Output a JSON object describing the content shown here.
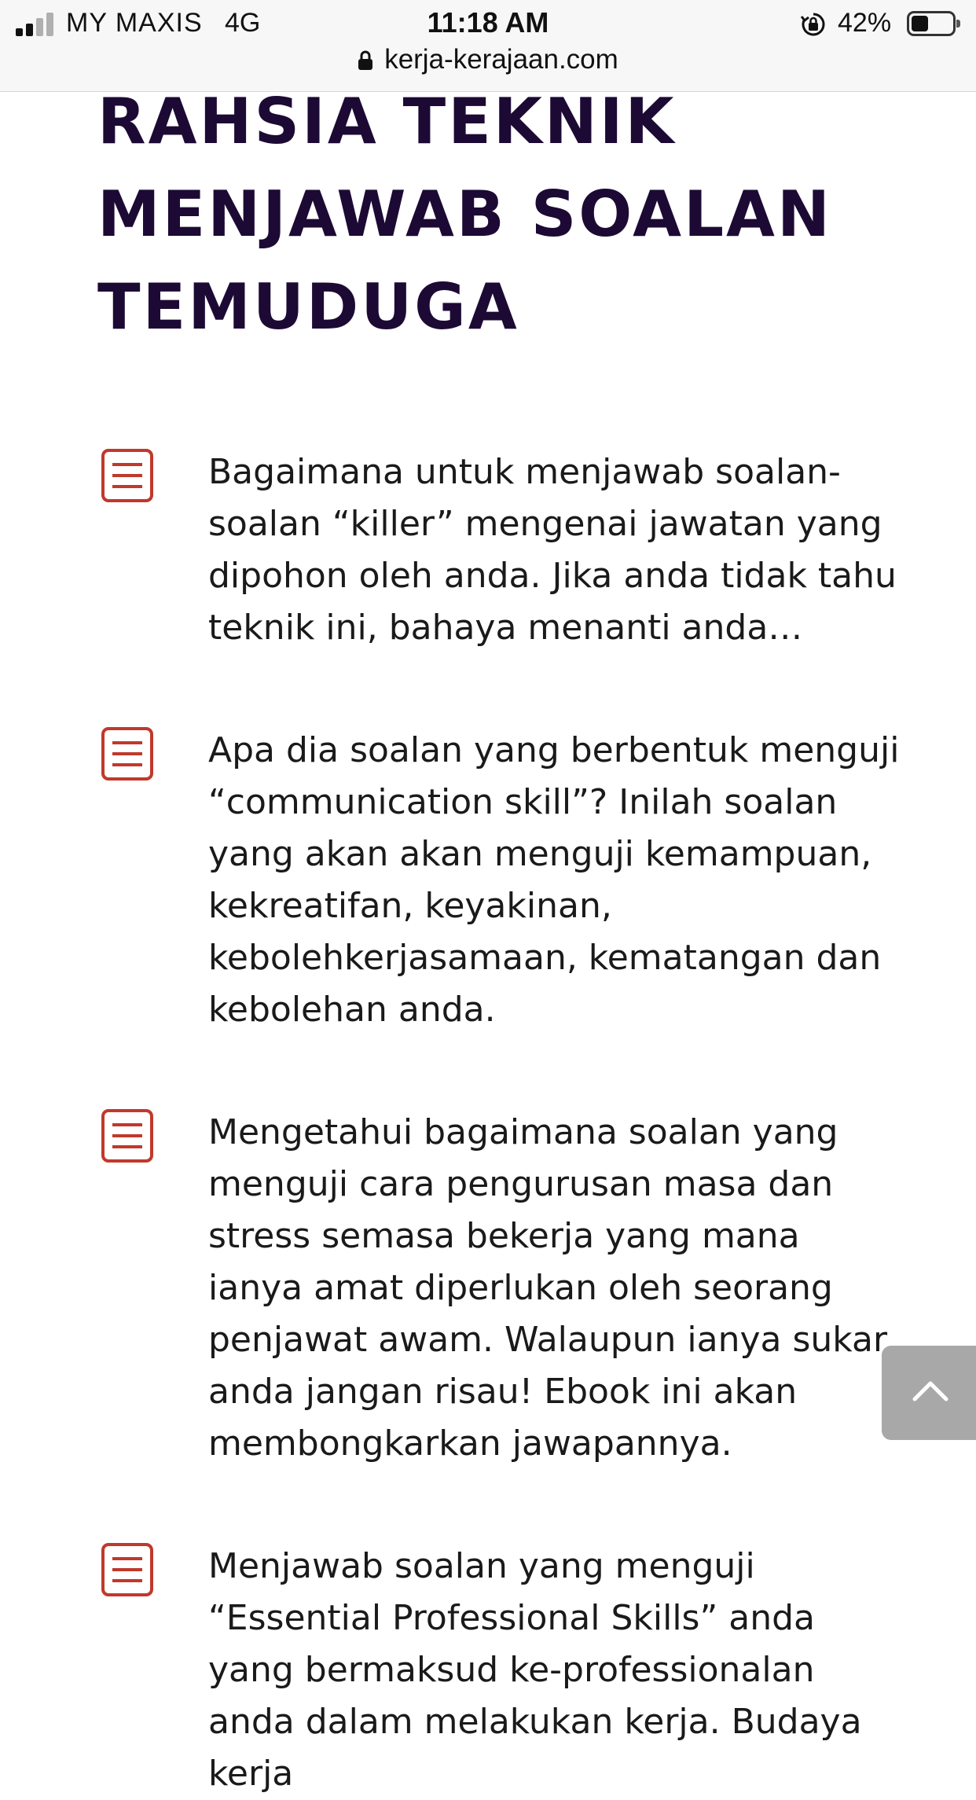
{
  "status_bar": {
    "carrier": "MY MAXIS",
    "network": "4G",
    "time": "11:18 AM",
    "battery_percent": "42%",
    "battery_level": 0.42
  },
  "browser": {
    "url": "kerja-kerajaan.com"
  },
  "page": {
    "title": "RAHSIA TEKNIK MENJAWAB SOALAN TEMUDUGA",
    "features": [
      {
        "icon": "document-list-icon",
        "text": "Bagaimana untuk menjawab soalan-soalan “killer” mengenai jawatan yang dipohon oleh anda. Jika anda tidak tahu teknik ini, bahaya menanti anda…"
      },
      {
        "icon": "document-list-icon",
        "text": "Apa dia soalan yang berbentuk menguji “communication skill”? Inilah soalan yang akan akan menguji kemampuan, kekreatifan, keyakinan, kebolehkerjasamaan, kematangan dan kebolehan anda."
      },
      {
        "icon": "document-list-icon",
        "text": "Mengetahui bagaimana soalan yang menguji cara pengurusan masa dan stress semasa bekerja yang mana ianya amat diperlukan oleh seorang penjawat awam. Walaupun ianya sukar, anda jangan risau! Ebook ini akan membongkarkan jawapannya."
      },
      {
        "icon": "document-list-icon",
        "text": "Menjawab soalan yang menguji “Essential Professional Skills” anda yang bermaksud ke-professionalan anda dalam melakukan kerja. Budaya kerja"
      }
    ]
  },
  "scroll_top": {
    "icon": "chevron-up-icon"
  },
  "colors": {
    "title": "#1c0a35",
    "icon": "#c0392b",
    "text": "#1a1a1a",
    "scroll_button": "#a8a8a8"
  }
}
